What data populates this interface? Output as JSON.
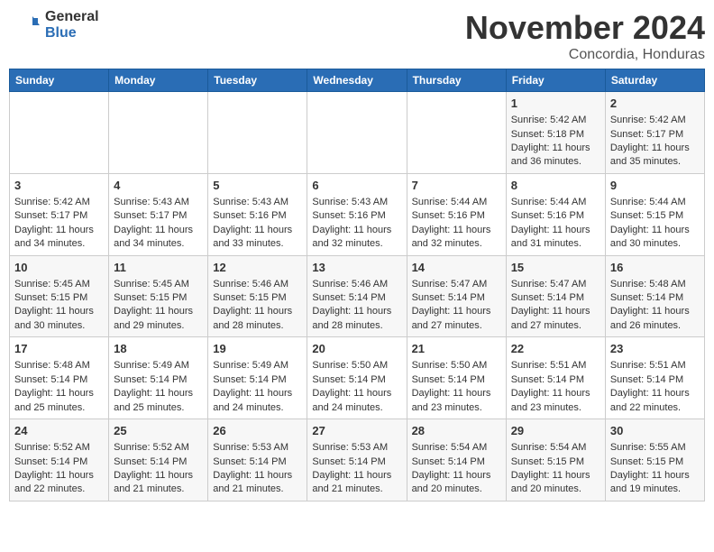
{
  "header": {
    "logo_line1": "General",
    "logo_line2": "Blue",
    "month_title": "November 2024",
    "location": "Concordia, Honduras"
  },
  "weekdays": [
    "Sunday",
    "Monday",
    "Tuesday",
    "Wednesday",
    "Thursday",
    "Friday",
    "Saturday"
  ],
  "weeks": [
    [
      {
        "day": "",
        "info": ""
      },
      {
        "day": "",
        "info": ""
      },
      {
        "day": "",
        "info": ""
      },
      {
        "day": "",
        "info": ""
      },
      {
        "day": "",
        "info": ""
      },
      {
        "day": "1",
        "info": "Sunrise: 5:42 AM\nSunset: 5:18 PM\nDaylight: 11 hours and 36 minutes."
      },
      {
        "day": "2",
        "info": "Sunrise: 5:42 AM\nSunset: 5:17 PM\nDaylight: 11 hours and 35 minutes."
      }
    ],
    [
      {
        "day": "3",
        "info": "Sunrise: 5:42 AM\nSunset: 5:17 PM\nDaylight: 11 hours and 34 minutes."
      },
      {
        "day": "4",
        "info": "Sunrise: 5:43 AM\nSunset: 5:17 PM\nDaylight: 11 hours and 34 minutes."
      },
      {
        "day": "5",
        "info": "Sunrise: 5:43 AM\nSunset: 5:16 PM\nDaylight: 11 hours and 33 minutes."
      },
      {
        "day": "6",
        "info": "Sunrise: 5:43 AM\nSunset: 5:16 PM\nDaylight: 11 hours and 32 minutes."
      },
      {
        "day": "7",
        "info": "Sunrise: 5:44 AM\nSunset: 5:16 PM\nDaylight: 11 hours and 32 minutes."
      },
      {
        "day": "8",
        "info": "Sunrise: 5:44 AM\nSunset: 5:16 PM\nDaylight: 11 hours and 31 minutes."
      },
      {
        "day": "9",
        "info": "Sunrise: 5:44 AM\nSunset: 5:15 PM\nDaylight: 11 hours and 30 minutes."
      }
    ],
    [
      {
        "day": "10",
        "info": "Sunrise: 5:45 AM\nSunset: 5:15 PM\nDaylight: 11 hours and 30 minutes."
      },
      {
        "day": "11",
        "info": "Sunrise: 5:45 AM\nSunset: 5:15 PM\nDaylight: 11 hours and 29 minutes."
      },
      {
        "day": "12",
        "info": "Sunrise: 5:46 AM\nSunset: 5:15 PM\nDaylight: 11 hours and 28 minutes."
      },
      {
        "day": "13",
        "info": "Sunrise: 5:46 AM\nSunset: 5:14 PM\nDaylight: 11 hours and 28 minutes."
      },
      {
        "day": "14",
        "info": "Sunrise: 5:47 AM\nSunset: 5:14 PM\nDaylight: 11 hours and 27 minutes."
      },
      {
        "day": "15",
        "info": "Sunrise: 5:47 AM\nSunset: 5:14 PM\nDaylight: 11 hours and 27 minutes."
      },
      {
        "day": "16",
        "info": "Sunrise: 5:48 AM\nSunset: 5:14 PM\nDaylight: 11 hours and 26 minutes."
      }
    ],
    [
      {
        "day": "17",
        "info": "Sunrise: 5:48 AM\nSunset: 5:14 PM\nDaylight: 11 hours and 25 minutes."
      },
      {
        "day": "18",
        "info": "Sunrise: 5:49 AM\nSunset: 5:14 PM\nDaylight: 11 hours and 25 minutes."
      },
      {
        "day": "19",
        "info": "Sunrise: 5:49 AM\nSunset: 5:14 PM\nDaylight: 11 hours and 24 minutes."
      },
      {
        "day": "20",
        "info": "Sunrise: 5:50 AM\nSunset: 5:14 PM\nDaylight: 11 hours and 24 minutes."
      },
      {
        "day": "21",
        "info": "Sunrise: 5:50 AM\nSunset: 5:14 PM\nDaylight: 11 hours and 23 minutes."
      },
      {
        "day": "22",
        "info": "Sunrise: 5:51 AM\nSunset: 5:14 PM\nDaylight: 11 hours and 23 minutes."
      },
      {
        "day": "23",
        "info": "Sunrise: 5:51 AM\nSunset: 5:14 PM\nDaylight: 11 hours and 22 minutes."
      }
    ],
    [
      {
        "day": "24",
        "info": "Sunrise: 5:52 AM\nSunset: 5:14 PM\nDaylight: 11 hours and 22 minutes."
      },
      {
        "day": "25",
        "info": "Sunrise: 5:52 AM\nSunset: 5:14 PM\nDaylight: 11 hours and 21 minutes."
      },
      {
        "day": "26",
        "info": "Sunrise: 5:53 AM\nSunset: 5:14 PM\nDaylight: 11 hours and 21 minutes."
      },
      {
        "day": "27",
        "info": "Sunrise: 5:53 AM\nSunset: 5:14 PM\nDaylight: 11 hours and 21 minutes."
      },
      {
        "day": "28",
        "info": "Sunrise: 5:54 AM\nSunset: 5:14 PM\nDaylight: 11 hours and 20 minutes."
      },
      {
        "day": "29",
        "info": "Sunrise: 5:54 AM\nSunset: 5:15 PM\nDaylight: 11 hours and 20 minutes."
      },
      {
        "day": "30",
        "info": "Sunrise: 5:55 AM\nSunset: 5:15 PM\nDaylight: 11 hours and 19 minutes."
      }
    ]
  ]
}
